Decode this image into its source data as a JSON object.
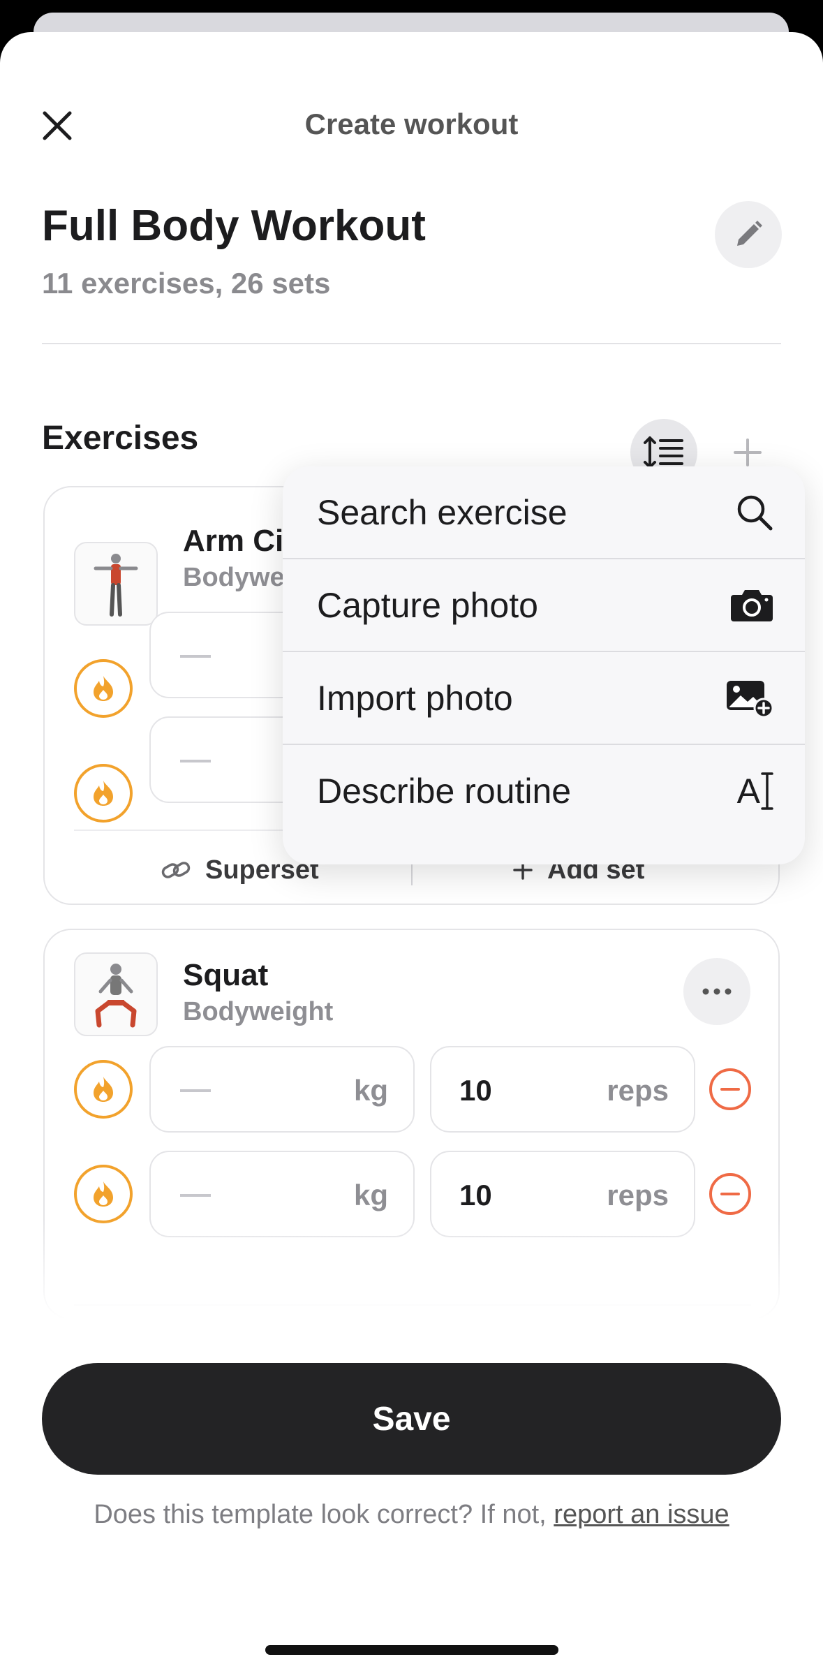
{
  "header": {
    "title": "Create workout"
  },
  "workout": {
    "title": "Full Body Workout",
    "summary": "11 exercises, 26 sets"
  },
  "exercises_section": {
    "heading": "Exercises"
  },
  "exercises": [
    {
      "name": "Arm Ci",
      "type": "Bodywe",
      "sets": [
        {
          "weight": "—"
        },
        {
          "weight": "—"
        }
      ],
      "actions": {
        "superset": "Superset",
        "add_set": "Add set"
      }
    },
    {
      "name": "Squat",
      "type": "Bodyweight",
      "sets": [
        {
          "weight_unit": "kg",
          "reps": "10",
          "reps_unit": "reps"
        },
        {
          "weight_unit": "kg",
          "reps": "10",
          "reps_unit": "reps"
        }
      ]
    }
  ],
  "add_menu": {
    "items": [
      {
        "label": "Search exercise",
        "icon": "search-icon"
      },
      {
        "label": "Capture photo",
        "icon": "camera-icon"
      },
      {
        "label": "Import photo",
        "icon": "import-photo-icon"
      },
      {
        "label": "Describe routine",
        "icon": "text-cursor-icon"
      }
    ],
    "describe_icon_text": "A"
  },
  "footer": {
    "save_label": "Save",
    "report_text": "Does this template look correct? If not,",
    "report_link": "report an issue"
  },
  "colors": {
    "accent_warm": "#f2a22c",
    "remove": "#ef6a45",
    "save_bg": "#232325"
  }
}
